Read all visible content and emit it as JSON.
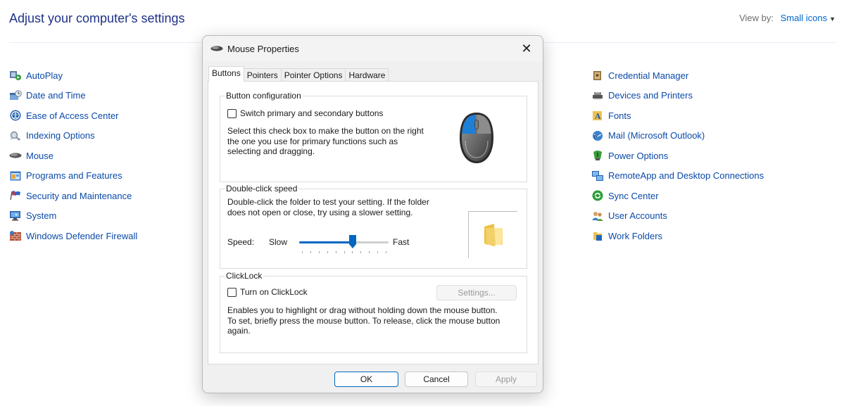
{
  "control_panel": {
    "title": "Adjust your computer's settings",
    "view_by_label": "View by:",
    "view_by_value": "Small icons",
    "left_items": [
      {
        "label": "AutoPlay",
        "icon": "autoplay-icon"
      },
      {
        "label": "Date and Time",
        "icon": "date-time-icon"
      },
      {
        "label": "Ease of Access Center",
        "icon": "ease-of-access-icon"
      },
      {
        "label": "Indexing Options",
        "icon": "indexing-icon"
      },
      {
        "label": "Mouse",
        "icon": "mouse-icon"
      },
      {
        "label": "Programs and Features",
        "icon": "programs-icon"
      },
      {
        "label": "Security and Maintenance",
        "icon": "flag-icon"
      },
      {
        "label": "System",
        "icon": "system-icon"
      },
      {
        "label": "Windows Defender Firewall",
        "icon": "firewall-icon"
      }
    ],
    "right_items": [
      {
        "label": "Credential Manager",
        "icon": "credential-icon"
      },
      {
        "label": "Devices and Printers",
        "icon": "devices-icon"
      },
      {
        "label": "Fonts",
        "icon": "fonts-icon"
      },
      {
        "label": "Mail (Microsoft Outlook)",
        "icon": "mail-icon"
      },
      {
        "label": "Power Options",
        "icon": "power-icon"
      },
      {
        "label": "RemoteApp and Desktop Connections",
        "icon": "remoteapp-icon"
      },
      {
        "label": "Sync Center",
        "icon": "sync-icon"
      },
      {
        "label": "User Accounts",
        "icon": "users-icon"
      },
      {
        "label": "Work Folders",
        "icon": "work-folders-icon"
      }
    ]
  },
  "dialog": {
    "title": "Mouse Properties",
    "close_glyph": "✕",
    "tabs": [
      "Buttons",
      "Pointers",
      "Pointer Options",
      "Hardware"
    ],
    "active_tab": "Buttons",
    "button_config": {
      "label": "Button configuration",
      "checkbox_label": "Switch primary and secondary buttons",
      "checked": false,
      "description_lines": [
        "Select this check box to make the button on the right",
        "the one you use for primary functions such as",
        "selecting and dragging."
      ]
    },
    "double_click": {
      "label": "Double-click speed",
      "description_lines": [
        "Double-click the folder to test your setting. If the folder",
        "does not open or close, try using a slower setting."
      ],
      "speed_label": "Speed:",
      "slow_label": "Slow",
      "fast_label": "Fast",
      "speed_fraction": 0.6
    },
    "clicklock": {
      "label": "ClickLock",
      "checkbox_label": "Turn on ClickLock",
      "checked": false,
      "settings_button": "Settings...",
      "description_lines": [
        "Enables you to highlight or drag without holding down the mouse button.",
        "To set, briefly press the mouse button. To release, click the mouse button",
        "again."
      ]
    },
    "buttons": {
      "ok": "OK",
      "cancel": "Cancel",
      "apply": "Apply"
    }
  },
  "colors": {
    "link": "#0a4aa8",
    "title": "#1e3287",
    "accent": "#0067c0"
  }
}
